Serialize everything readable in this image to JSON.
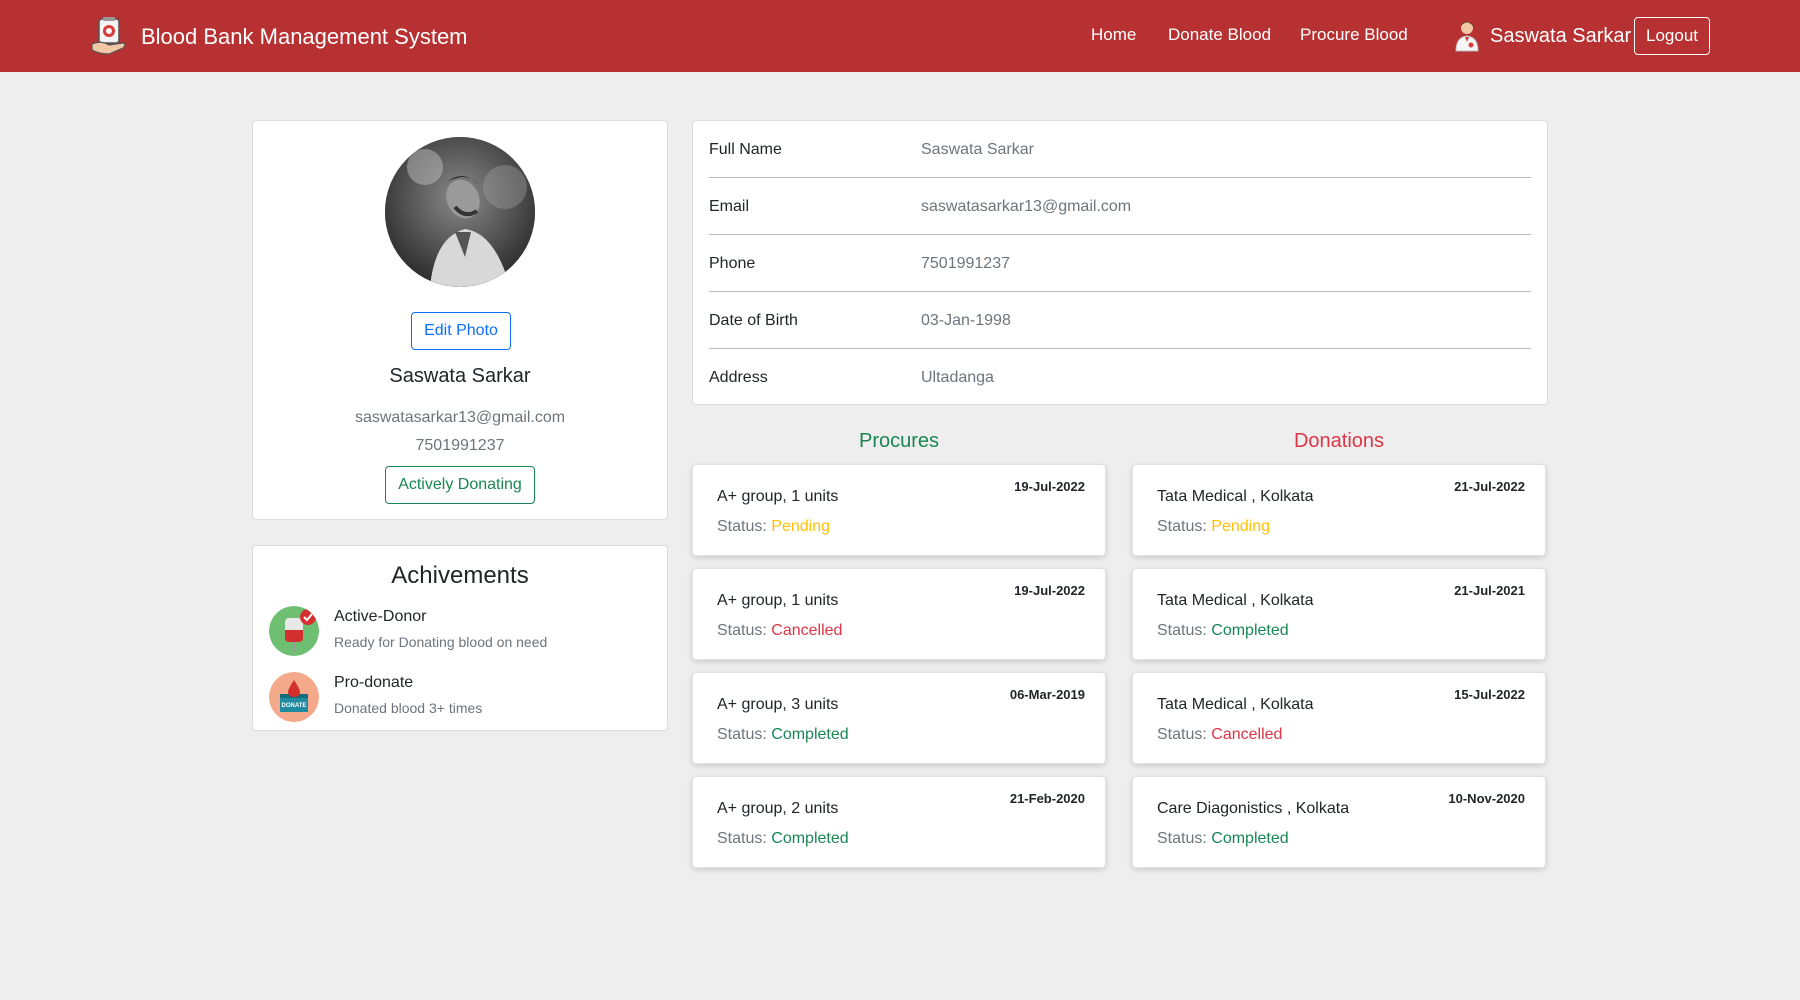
{
  "navbar": {
    "brand": "Blood Bank Management System",
    "links": [
      "Home",
      "Donate Blood",
      "Procure Blood"
    ],
    "user": "Saswata Sarkar",
    "logout": "Logout"
  },
  "profile": {
    "edit_photo": "Edit Photo",
    "name": "Saswata Sarkar",
    "email": "saswatasarkar13@gmail.com",
    "phone": "7501991237",
    "status": "Actively Donating"
  },
  "achievements": {
    "title": "Achivements",
    "items": [
      {
        "name": "Active-Donor",
        "desc": "Ready for Donating blood on need",
        "icon": "active-donor-icon"
      },
      {
        "name": "Pro-donate",
        "desc": "Donated blood 3+ times",
        "icon": "pro-donate-icon",
        "badge_text": "DONATE"
      }
    ]
  },
  "info": {
    "rows": [
      {
        "label": "Full Name",
        "value": "Saswata Sarkar"
      },
      {
        "label": "Email",
        "value": "saswatasarkar13@gmail.com"
      },
      {
        "label": "Phone",
        "value": "7501991237"
      },
      {
        "label": "Date of Birth",
        "value": "03-Jan-1998"
      },
      {
        "label": "Address",
        "value": "Ultadanga"
      }
    ]
  },
  "procures": {
    "title": "Procures",
    "status_label": "Status:",
    "items": [
      {
        "title": "A+ group, 1 units",
        "date": "19-Jul-2022",
        "status": "Pending"
      },
      {
        "title": "A+ group, 1 units",
        "date": "19-Jul-2022",
        "status": "Cancelled"
      },
      {
        "title": "A+ group, 3 units",
        "date": "06-Mar-2019",
        "status": "Completed"
      },
      {
        "title": "A+ group, 2 units",
        "date": "21-Feb-2020",
        "status": "Completed"
      }
    ]
  },
  "donations": {
    "title": "Donations",
    "status_label": "Status:",
    "items": [
      {
        "title": "Tata Medical , Kolkata",
        "date": "21-Jul-2022",
        "status": "Pending"
      },
      {
        "title": "Tata Medical , Kolkata",
        "date": "21-Jul-2021",
        "status": "Completed"
      },
      {
        "title": "Tata Medical , Kolkata",
        "date": "15-Jul-2022",
        "status": "Cancelled"
      },
      {
        "title": "Care Diagonistics , Kolkata",
        "date": "10-Nov-2020",
        "status": "Completed"
      }
    ]
  },
  "colors": {
    "navbar": "#b83132",
    "pending": "#ffc107",
    "cancelled": "#dc3545",
    "completed": "#198754",
    "primary": "#0d6efd"
  }
}
